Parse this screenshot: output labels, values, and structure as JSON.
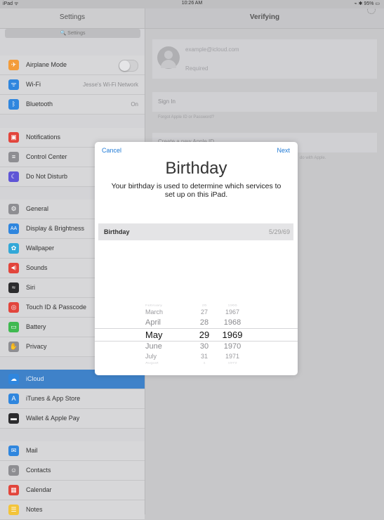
{
  "status_bar": {
    "left": "iPad ᯤ",
    "time": "10:26 AM",
    "right": "⌁ ✱ 95% ▭"
  },
  "sidebar": {
    "title": "Settings",
    "search_placeholder": "🔍 Settings",
    "items": [
      {
        "label": "Airplane Mode",
        "icon": "airplane-icon",
        "glyph": "✈",
        "color": "#f39c3a",
        "value": ""
      },
      {
        "label": "Wi-Fi",
        "icon": "wifi-icon",
        "glyph": "ᯤ",
        "color": "#2f86de",
        "value": "Jesse's Wi-Fi Network"
      },
      {
        "label": "Bluetooth",
        "icon": "bluetooth-icon",
        "glyph": "ᛒ",
        "color": "#2f86de",
        "value": "On"
      },
      {
        "label": "Notifications",
        "icon": "notifications-icon",
        "glyph": "▣",
        "color": "#e2453c",
        "value": ""
      },
      {
        "label": "Control Center",
        "icon": "control-center-icon",
        "glyph": "≡",
        "color": "#8e8e92",
        "value": ""
      },
      {
        "label": "Do Not Disturb",
        "icon": "moon-icon",
        "glyph": "☾",
        "color": "#5f55d6",
        "value": ""
      },
      {
        "label": "General",
        "icon": "gear-icon",
        "glyph": "⚙",
        "color": "#8e8e92",
        "value": ""
      },
      {
        "label": "Display & Brightness",
        "icon": "display-icon",
        "glyph": "AA",
        "color": "#2f86de",
        "value": ""
      },
      {
        "label": "Wallpaper",
        "icon": "wallpaper-icon",
        "glyph": "✿",
        "color": "#32a8d8",
        "value": ""
      },
      {
        "label": "Sounds",
        "icon": "sounds-icon",
        "glyph": "◀)",
        "color": "#e2453c",
        "value": ""
      },
      {
        "label": "Siri",
        "icon": "siri-icon",
        "glyph": "≈",
        "color": "#2c2c2e",
        "value": ""
      },
      {
        "label": "Touch ID & Passcode",
        "icon": "fingerprint-icon",
        "glyph": "◎",
        "color": "#e2453c",
        "value": ""
      },
      {
        "label": "Battery",
        "icon": "battery-icon",
        "glyph": "▭",
        "color": "#3fb950",
        "value": ""
      },
      {
        "label": "Privacy",
        "icon": "hand-icon",
        "glyph": "✋",
        "color": "#8e8e92",
        "value": ""
      },
      {
        "label": "iCloud",
        "icon": "icloud-icon",
        "glyph": "☁",
        "color": "#2f86de",
        "value": ""
      },
      {
        "label": "iTunes & App Store",
        "icon": "app-store-icon",
        "glyph": "A",
        "color": "#2f86de",
        "value": ""
      },
      {
        "label": "Wallet & Apple Pay",
        "icon": "wallet-icon",
        "glyph": "▬",
        "color": "#2c2c2e",
        "value": ""
      },
      {
        "label": "Mail",
        "icon": "mail-icon",
        "glyph": "✉",
        "color": "#2f86de",
        "value": ""
      },
      {
        "label": "Contacts",
        "icon": "contacts-icon",
        "glyph": "☺",
        "color": "#8e8e92",
        "value": ""
      },
      {
        "label": "Calendar",
        "icon": "calendar-icon",
        "glyph": "▦",
        "color": "#e2453c",
        "value": ""
      },
      {
        "label": "Notes",
        "icon": "notes-icon",
        "glyph": "☰",
        "color": "#f3c43a",
        "value": ""
      }
    ]
  },
  "detail": {
    "title": "Verifying",
    "apple_id_placeholder": "example@icloud.com",
    "password_placeholder": "Required",
    "sign_in": "Sign In",
    "forgot": "Forgot Apple ID or Password?",
    "create": "Create a new Apple ID",
    "note_fragment": "do with Apple."
  },
  "modal": {
    "cancel": "Cancel",
    "next": "Next",
    "title": "Birthday",
    "description": "Your birthday is used to determine which services to set up on this iPad.",
    "row_label": "Birthday",
    "row_value": "5/29/69",
    "picker": {
      "rows": [
        {
          "month": "February",
          "day": "26",
          "year": "1966"
        },
        {
          "month": "March",
          "day": "27",
          "year": "1967"
        },
        {
          "month": "April",
          "day": "28",
          "year": "1968"
        },
        {
          "month": "May",
          "day": "29",
          "year": "1969"
        },
        {
          "month": "June",
          "day": "30",
          "year": "1970"
        },
        {
          "month": "July",
          "day": "31",
          "year": "1971"
        },
        {
          "month": "August",
          "day": "1",
          "year": "1972"
        }
      ]
    }
  }
}
